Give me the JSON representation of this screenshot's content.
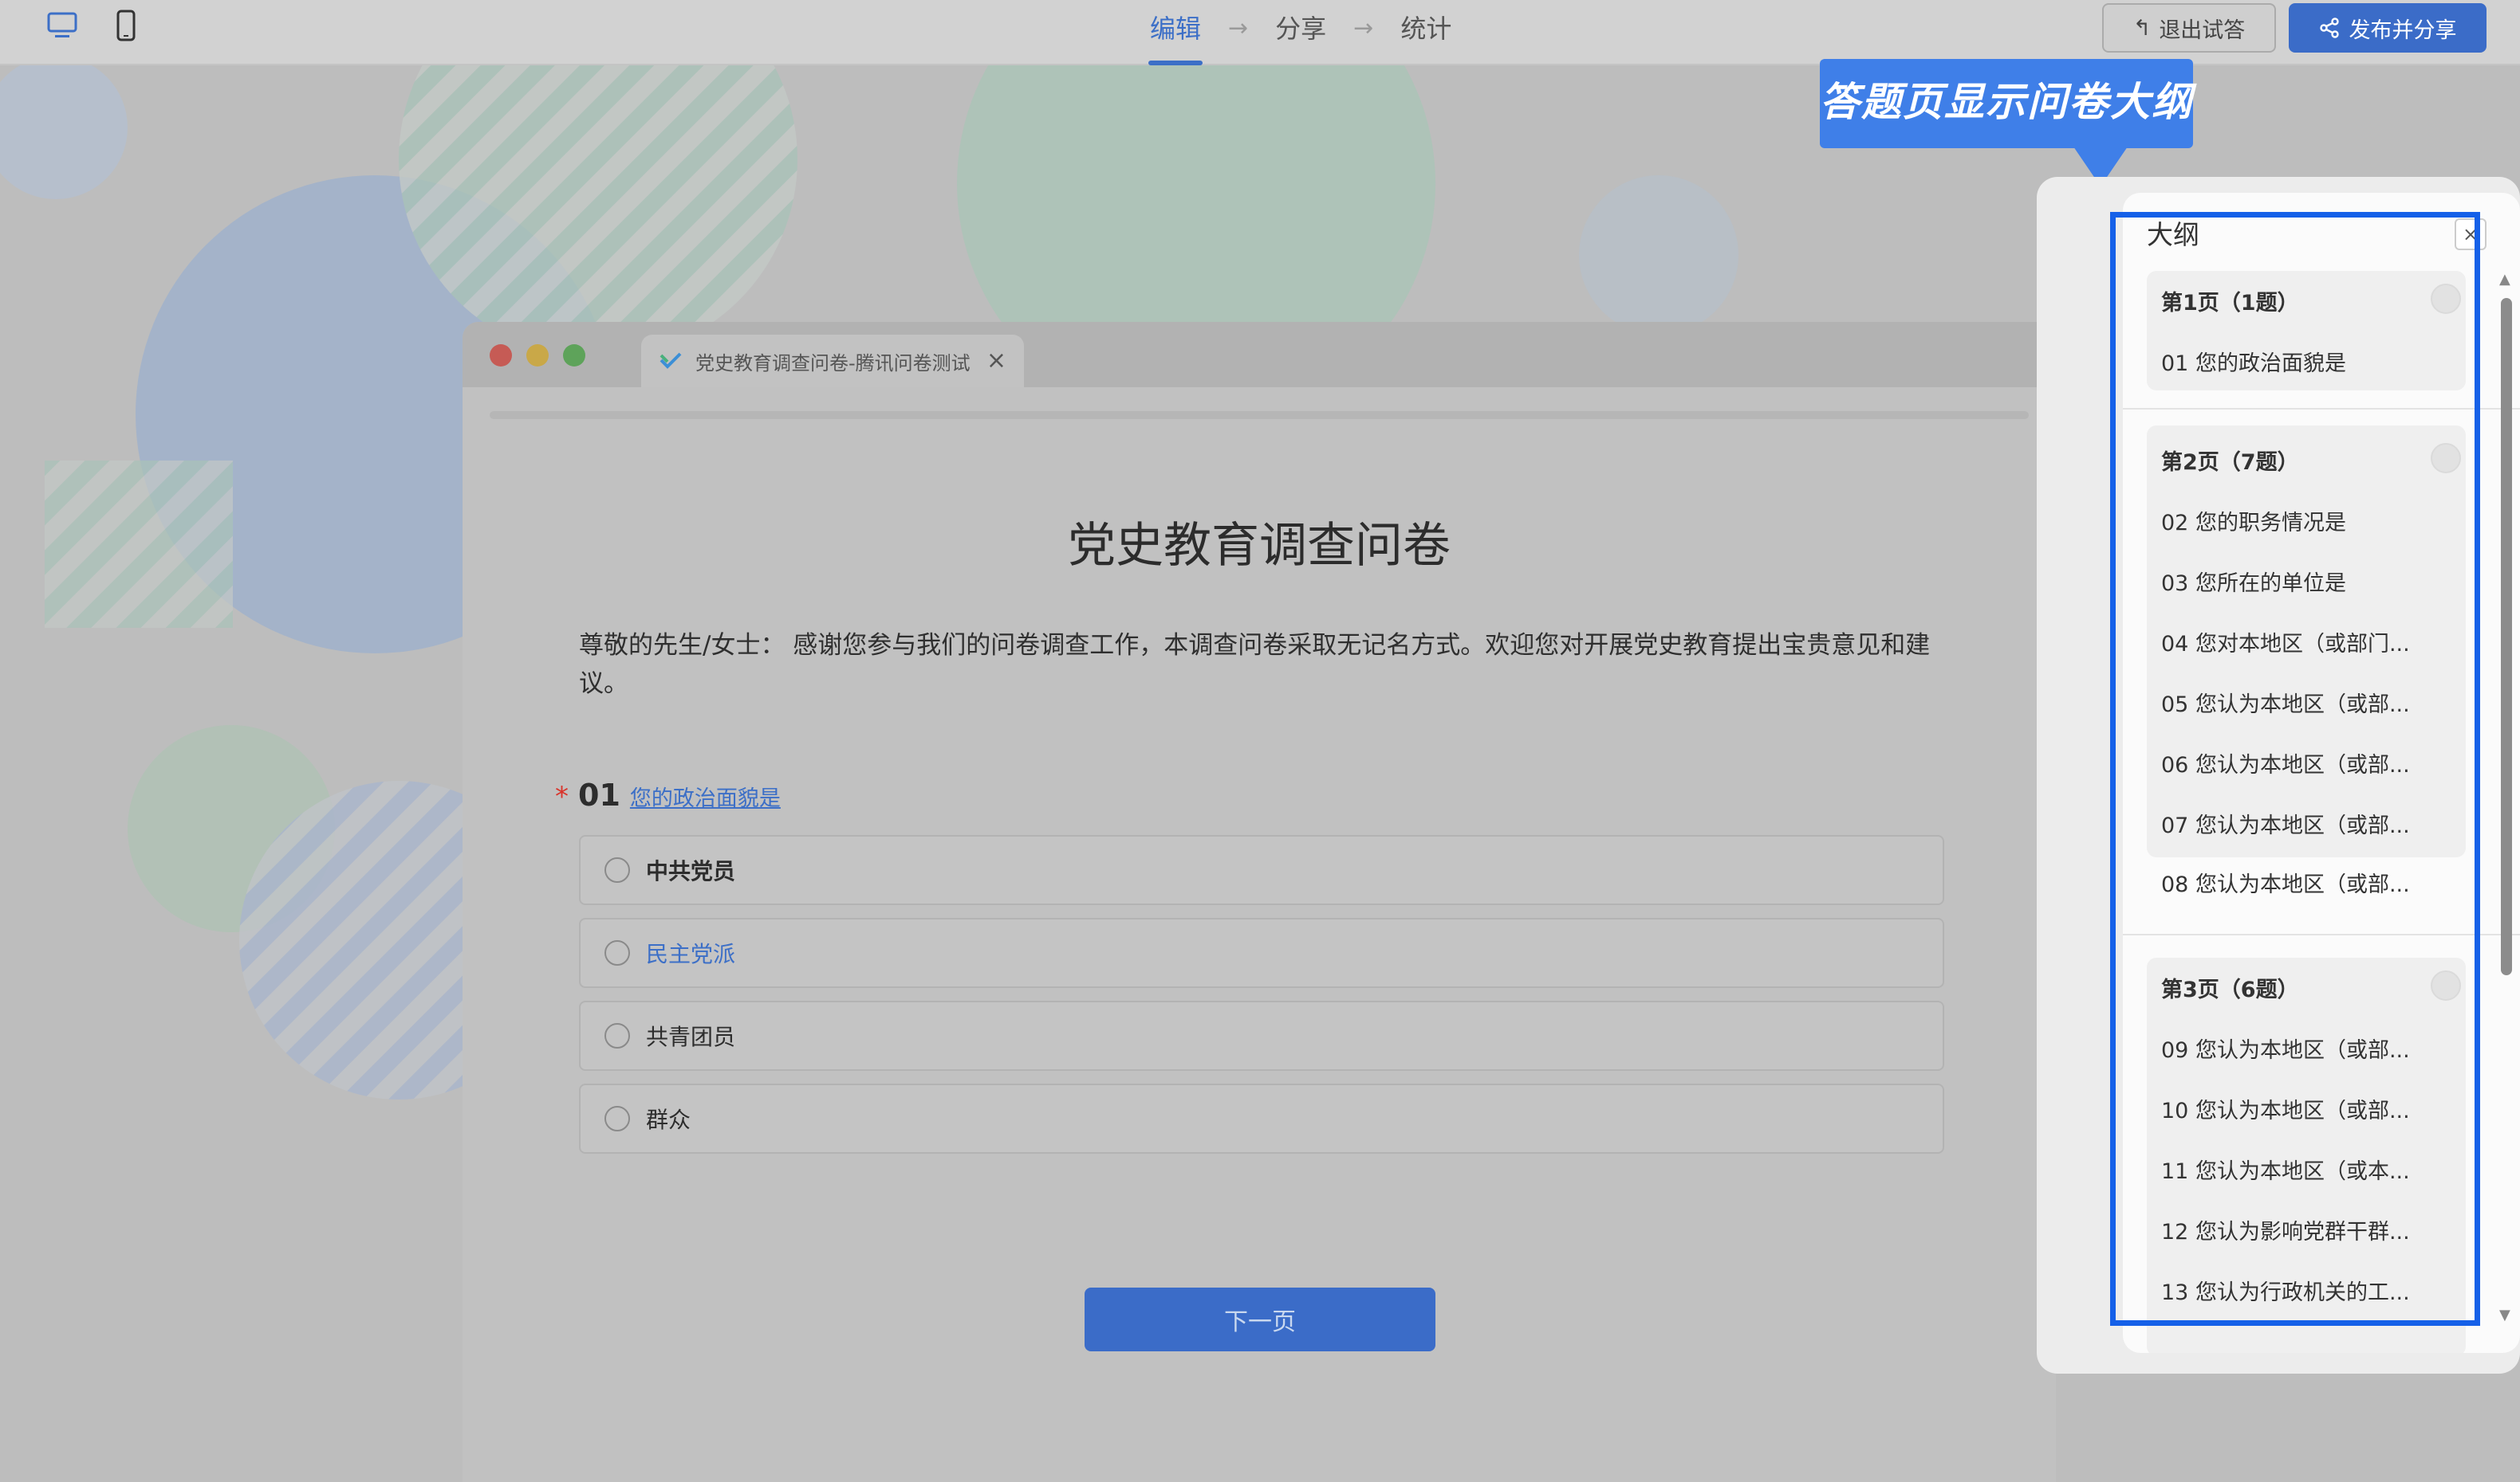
{
  "toolbar": {
    "device_icons": [
      "desktop-icon",
      "mobile-icon"
    ],
    "steps": [
      "编辑",
      "分享",
      "统计"
    ],
    "active_step": "编辑",
    "exit_label": "退出试答",
    "publish_label": "发布并分享"
  },
  "browser": {
    "tab_title": "党史教育调查问卷-腾讯问卷测试",
    "tab_close": "×"
  },
  "survey": {
    "title": "党史教育调查问卷",
    "intro": "尊敬的先生/女士： 感谢您参与我们的问卷调查工作，本调查问卷采取无记名方式。欢迎您对开展党史教育提出宝贵意见和建议。",
    "question": {
      "required_mark": "*",
      "number": "01",
      "title": "您的政治面貌是",
      "options": [
        "中共党员",
        "民主党派",
        "共青团员",
        "群众"
      ]
    },
    "next_label": "下一页"
  },
  "callout": {
    "text": "答题页显示问卷大纲"
  },
  "outline": {
    "header": "大纲",
    "collapse": "×",
    "groups": [
      {
        "title": "第1页（1题）",
        "items": [
          "01 您的政治面貌是"
        ]
      },
      {
        "title": "第2页（7题）",
        "items": [
          "02 您的职务情况是",
          "03 您所在的单位是",
          "04 您对本地区（或部门...",
          "05 您认为本地区（或部...",
          "06 您认为本地区（或部...",
          "07 您认为本地区（或部...",
          "08 您认为本地区（或部..."
        ]
      },
      {
        "title": "第3页（6题）",
        "items": [
          "09 您认为本地区（或部...",
          "10 您认为本地区（或部...",
          "11 您认为本地区（或本...",
          "12 您认为影响党群干群...",
          "13 您认为行政机关的工..."
        ]
      }
    ]
  },
  "colors": {
    "accent": "#3b6cc8",
    "callout": "#3f7fe8",
    "highlight_border": "#1560e8",
    "required": "#d9342b"
  }
}
